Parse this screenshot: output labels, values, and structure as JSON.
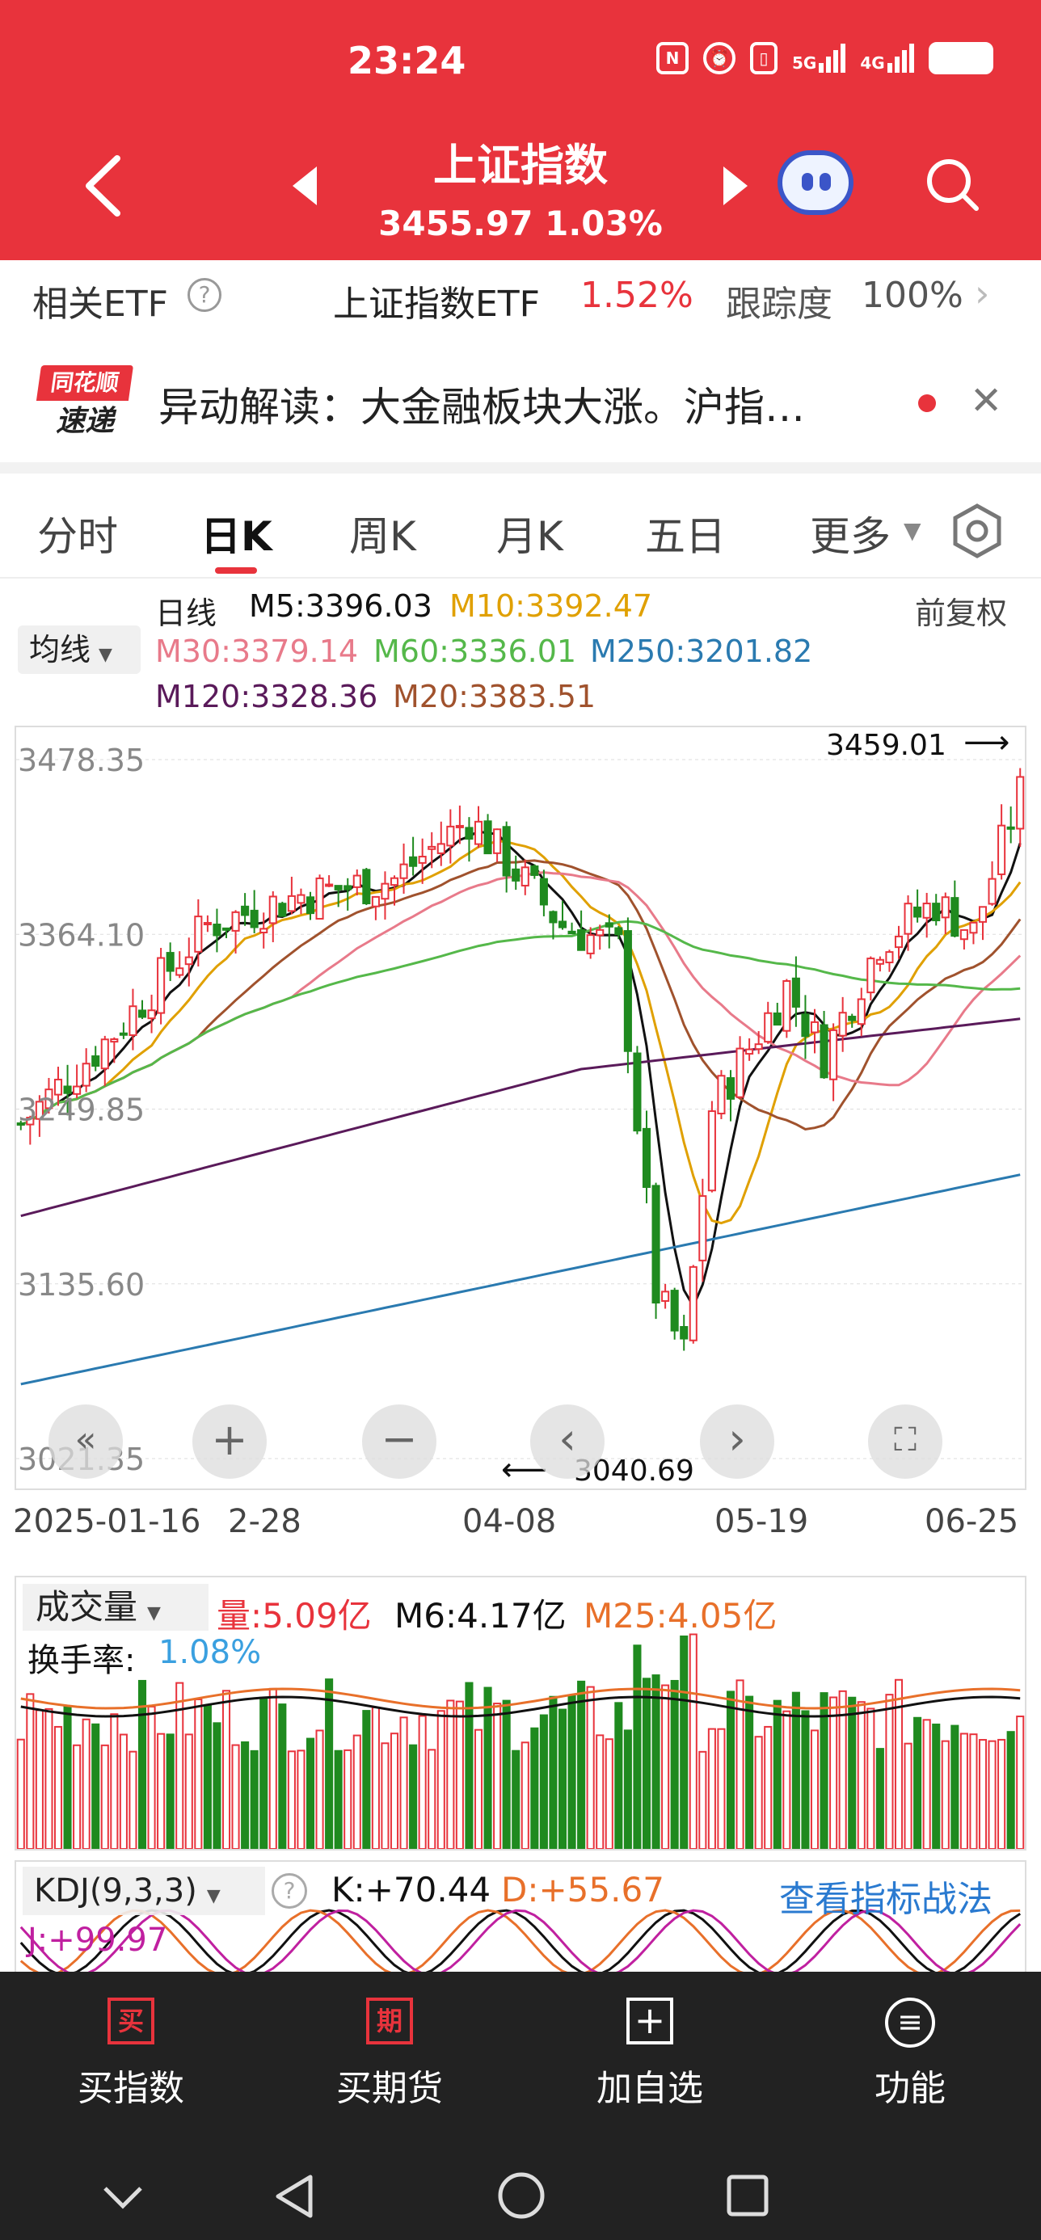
{
  "status": {
    "time": "23:24",
    "signal1": "5G",
    "signal2": "4G"
  },
  "header": {
    "title": "上证指数",
    "price": "3455.97",
    "change": "1.03%"
  },
  "etf": {
    "label": "相关ETF",
    "name": "上证指数ETF",
    "change": "1.52%",
    "track_label": "跟踪度",
    "track_value": "100%"
  },
  "news": {
    "logo_top": "同花顺",
    "logo_bottom": "速递",
    "text": "异动解读：大金融板块大涨。沪指…"
  },
  "tabs": [
    "分时",
    "日K",
    "周K",
    "月K",
    "五日",
    "更多"
  ],
  "ma": {
    "type_label": "均线",
    "line_label": "日线",
    "m5": "M5:3396.03",
    "m10": "M10:3392.47",
    "adjust": "前复权",
    "m30": "M30:3379.14",
    "m60": "M60:3336.01",
    "m250": "M250:3201.82",
    "m120": "M120:3328.36",
    "m20": "M20:3383.51"
  },
  "chart_data": {
    "type": "candlestick",
    "y_ticks": [
      "3478.35",
      "3364.10",
      "3249.85",
      "3135.60",
      "3021.35"
    ],
    "x_ticks": [
      "2025-01-16",
      "2-28",
      "04-08",
      "05-19",
      "06-25"
    ],
    "high_label": "3459.01",
    "low_label": "3040.69",
    "ylim": [
      3021.35,
      3478.35
    ],
    "ma_colors": {
      "m5": "#111111",
      "m10": "#e0a000",
      "m20": "#a0522d",
      "m30": "#e87a8a",
      "m60": "#55b84a",
      "m120": "#5a1a5a",
      "m250": "#2a7ab0"
    }
  },
  "volume": {
    "label": "成交量",
    "vol": "量:5.09亿",
    "m6": "M6:4.17亿",
    "m25": "M25:4.05亿",
    "turnover_label": "换手率:",
    "turnover_value": "1.08%"
  },
  "kdj": {
    "label": "KDJ(9,3,3)",
    "k": "K:+70.44",
    "d": "D:+55.67",
    "link": "查看指标战法",
    "j": "J:+99.97"
  },
  "bottom": {
    "buy_index": "买指数",
    "buy_futures": "买期货",
    "add_watch": "加自选",
    "functions": "功能",
    "buy_icon": "买",
    "futures_icon": "期"
  },
  "colors": {
    "accent": "#e8333c",
    "up": "#e8333c",
    "down": "#1f8a1f",
    "link": "#2a7ad0"
  }
}
